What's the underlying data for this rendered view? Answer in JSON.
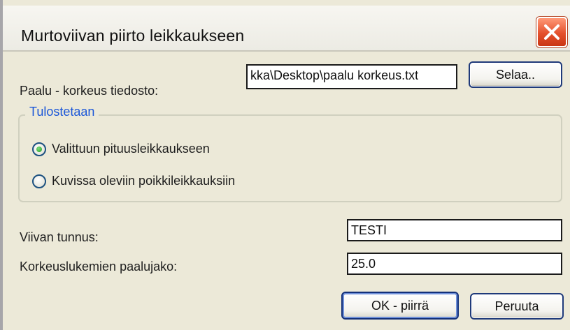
{
  "dialog": {
    "title": "Murtoviivan piirto leikkaukseen"
  },
  "file_row": {
    "label": "Paalu - korkeus tiedosto:",
    "value": "kka\\Desktop\\paalu korkeus.txt",
    "browse_label": "Selaa.."
  },
  "output_group": {
    "legend": "Tulostetaan",
    "options": [
      {
        "label": "Valittuun pituusleikkaukseen",
        "selected": true
      },
      {
        "label": "Kuvissa oleviin poikkileikkauksiin",
        "selected": false
      }
    ]
  },
  "line_id": {
    "label": "Viivan tunnus:",
    "value": "TESTI"
  },
  "interval": {
    "label": "Korkeuslukemien paalujako:",
    "value": "25.0"
  },
  "buttons": {
    "ok": "OK - piirrä",
    "cancel": "Peruuta"
  },
  "colors": {
    "dialog_bg": "#ece9d8",
    "group_legend": "#1a56d8",
    "close_button": "#e4502c",
    "radio_dot": "#1e9a1e"
  }
}
